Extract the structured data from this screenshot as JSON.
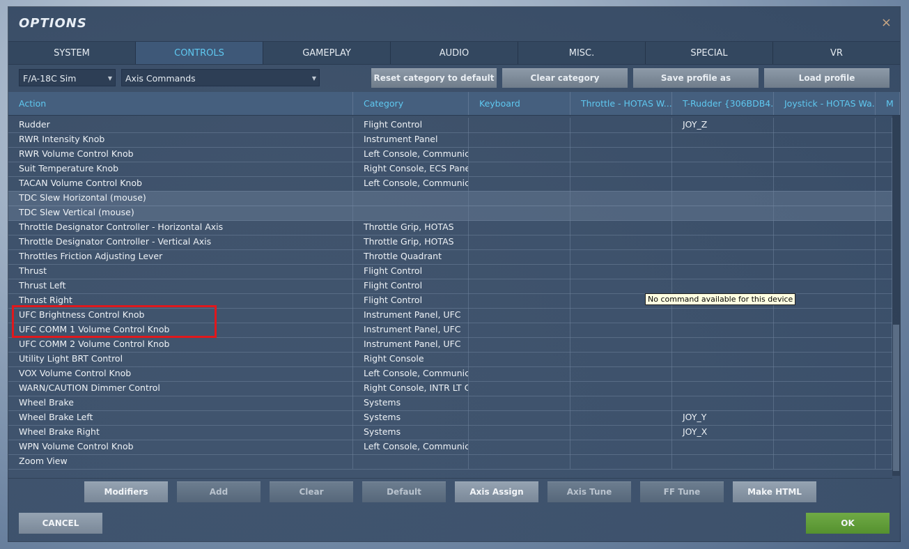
{
  "window": {
    "title": "OPTIONS",
    "close_label": "×"
  },
  "tabs": [
    "SYSTEM",
    "CONTROLS",
    "GAMEPLAY",
    "AUDIO",
    "MISC.",
    "SPECIAL",
    "VR"
  ],
  "active_tab": "CONTROLS",
  "toolbar": {
    "aircraft_select": "F/A-18C Sim",
    "category_select": "Axis Commands",
    "reset_label": "Reset category to default",
    "clear_category_label": "Clear category",
    "save_profile_label": "Save profile as",
    "load_profile_label": "Load profile"
  },
  "table": {
    "headers": [
      "Action",
      "Category",
      "Keyboard",
      "Throttle - HOTAS W...",
      "T-Rudder {306BDB4...",
      "Joystick - HOTAS Wa...",
      "M"
    ],
    "rows": [
      {
        "action": "Rudder",
        "category": "Flight Control",
        "rudder": "JOY_Z"
      },
      {
        "action": "RWR Intensity Knob",
        "category": "Instrument Panel",
        "rudder": ""
      },
      {
        "action": "RWR Volume Control Knob",
        "category": "Left Console, Communicat",
        "rudder": ""
      },
      {
        "action": "Suit Temperature Knob",
        "category": "Right Console, ECS Panel",
        "rudder": ""
      },
      {
        "action": "TACAN Volume Control Knob",
        "category": "Left Console, Communicat",
        "rudder": ""
      },
      {
        "action": "TDC Slew Horizontal (mouse)",
        "category": "",
        "rudder": ""
      },
      {
        "action": "TDC Slew Vertical (mouse)",
        "category": "",
        "rudder": ""
      },
      {
        "action": "Throttle Designator Controller - Horizontal Axis",
        "category": "Throttle Grip, HOTAS",
        "rudder": ""
      },
      {
        "action": "Throttle Designator Controller - Vertical Axis",
        "category": "Throttle Grip, HOTAS",
        "rudder": ""
      },
      {
        "action": "Throttles Friction Adjusting Lever",
        "category": "Throttle Quadrant",
        "rudder": ""
      },
      {
        "action": "Thrust",
        "category": "Flight Control",
        "rudder": ""
      },
      {
        "action": "Thrust Left",
        "category": "Flight Control",
        "rudder": ""
      },
      {
        "action": "Thrust Right",
        "category": "Flight Control",
        "rudder": ""
      },
      {
        "action": "UFC Brightness Control Knob",
        "category": "Instrument Panel, UFC",
        "rudder": ""
      },
      {
        "action": "UFC COMM 1 Volume Control Knob",
        "category": "Instrument Panel, UFC",
        "rudder": ""
      },
      {
        "action": "UFC COMM 2 Volume Control Knob",
        "category": "Instrument Panel, UFC",
        "rudder": ""
      },
      {
        "action": "Utility Light BRT Control",
        "category": "Right Console",
        "rudder": ""
      },
      {
        "action": "VOX Volume Control Knob",
        "category": "Left Console, Communicat",
        "rudder": ""
      },
      {
        "action": "WARN/CAUTION Dimmer Control",
        "category": "Right Console, INTR LT Co",
        "rudder": ""
      },
      {
        "action": "Wheel Brake",
        "category": "Systems",
        "rudder": ""
      },
      {
        "action": "Wheel Brake Left",
        "category": "Systems",
        "rudder": "JOY_Y"
      },
      {
        "action": "Wheel Brake Right",
        "category": "Systems",
        "rudder": "JOY_X"
      },
      {
        "action": "WPN Volume Control Knob",
        "category": "Left Console, Communicat",
        "rudder": ""
      },
      {
        "action": "Zoom View",
        "category": "",
        "rudder": ""
      }
    ]
  },
  "tooltip": "No command available for this device",
  "bottom_buttons": [
    "Modifiers",
    "Add",
    "Clear",
    "Default",
    "Axis Assign",
    "Axis Tune",
    "FF Tune",
    "Make HTML"
  ],
  "footer": {
    "cancel_label": "CANCEL",
    "ok_label": "OK"
  }
}
